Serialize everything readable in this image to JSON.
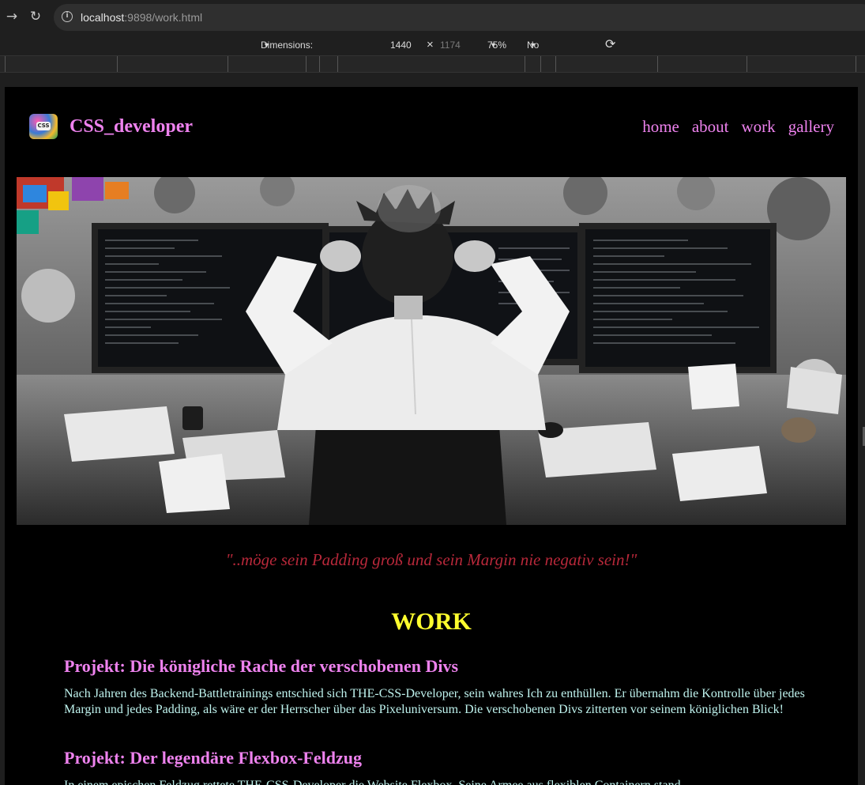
{
  "browser": {
    "url_host": "localhost",
    "url_rest": ":9898/work.html",
    "back_glyph": "→",
    "reload_glyph": "↻",
    "info_glyph": "i"
  },
  "devtools": {
    "dimensions_label": "Dimensions: Responsive",
    "width_value": "1440",
    "times": "×",
    "height_value": "1174",
    "zoom": "75%",
    "throttling": "No throttling",
    "rotate_glyph": "⟳"
  },
  "site": {
    "logo_text": "CSS",
    "brand": "CSS_developer",
    "nav": [
      "home",
      "about",
      "work",
      "gallery"
    ]
  },
  "hero": {
    "image": "developer-at-messy-desk-with-monitors"
  },
  "quote": "\"..möge sein Padding groß und sein Margin nie negativ sein!\"",
  "heading": "WORK",
  "projects": [
    {
      "title": "Projekt: Die königliche Rache der verschobenen Divs",
      "text": "Nach Jahren des Backend-Battletrainings entschied sich THE-CSS-Developer, sein wahres Ich zu enthüllen. Er übernahm die Kontrolle über jedes Margin und jedes Padding, als wäre er der Herrscher über das Pixeluniversum. Die verschobenen Divs zitterten vor seinem königlichen Blick!"
    },
    {
      "title": "Projekt: Der legendäre Flexbox-Feldzug",
      "text": "In einem epischen Feldzug rettete THE-CSS-Developer die Website Flexbox. Seine Armee aus flexiblen Containern stand ..."
    }
  ],
  "colors": {
    "accent_pink": "#ee82ee",
    "quote_red": "#b8283a",
    "heading_yellow": "#ffff2e",
    "body_text": "#bff3ee"
  }
}
